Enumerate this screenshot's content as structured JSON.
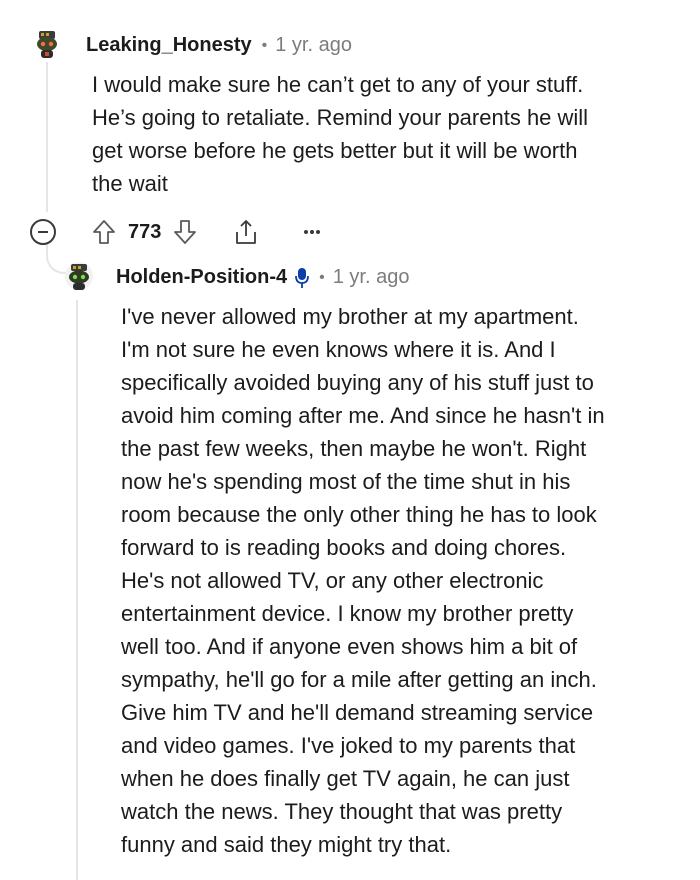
{
  "comments": [
    {
      "username": "Leaking_Honesty",
      "separator": "•",
      "time": "1 yr. ago",
      "body": "I would make sure he can’t get to any of your stuff.\nHe’s going to retaliate. Remind your parents he will\nget worse before he gets better but it will be worth\nthe wait",
      "votes": "773"
    },
    {
      "username": "Holden-Position-4",
      "separator": "•",
      "time": "1 yr. ago",
      "body": "I've never allowed my brother at my apartment.\nI'm not sure he even knows where it is. And I\nspecifically avoided buying any of his stuff just to\navoid him coming after me. And since he hasn't in\nthe past few weeks, then maybe he won't. Right\nnow he's spending most of the time shut in his\nroom because the only other thing he has to look\nforward to is reading books and doing chores.\nHe's not allowed TV, or any other electronic\nentertainment device. I know my brother pretty\nwell too. And if anyone even shows him a bit of\nsympathy, he'll go for a mile after getting an inch.\nGive him TV and he'll demand streaming service\nand video games. I've joked to my parents that\nwhen he does finally get TV again, he can just\nwatch the news. They thought that was pretty\nfunny and said they might try that."
    }
  ],
  "icons": {
    "avatar": "snoo-avatar-icon",
    "collapse": "collapse-icon",
    "upvote": "upvote-arrow-icon",
    "downvote": "downvote-arrow-icon",
    "share": "share-icon",
    "more": "more-options-icon",
    "mic": "microphone-icon"
  },
  "colors": {
    "text": "#1c1c1c",
    "meta": "#7c7c7c",
    "mic": "#0a3fa8",
    "threadline": "#e5e5e5"
  }
}
